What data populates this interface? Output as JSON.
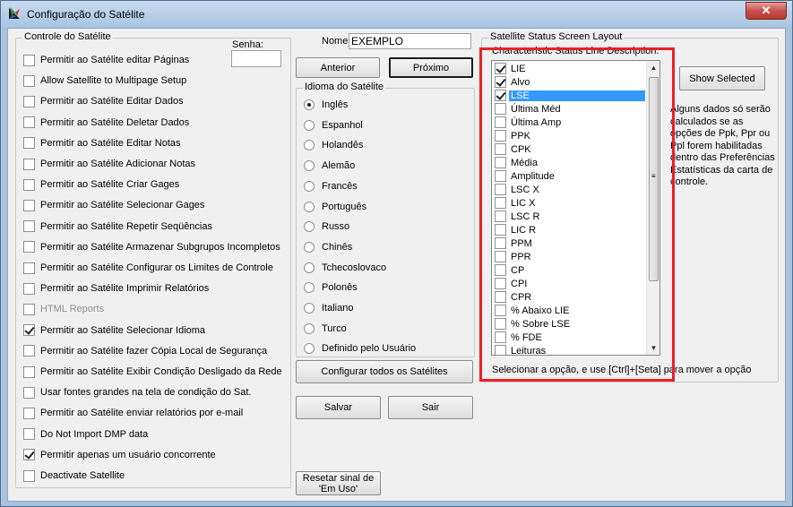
{
  "window": {
    "title": "Configuração do Satélite",
    "close_label": "✕",
    "accent": "#3399ff",
    "highlight": "#e8202a"
  },
  "controle": {
    "legend": "Controle do Satélite",
    "senha_label": "Senha:",
    "senha_value": "",
    "items": [
      {
        "label": "Permitir ao Satélite editar Páginas",
        "checked": false,
        "disabled": false
      },
      {
        "label": "Allow Satellite to Multipage Setup",
        "checked": false,
        "disabled": false
      },
      {
        "label": "Permitir ao Satélite Editar Dados",
        "checked": false,
        "disabled": false
      },
      {
        "label": "Permitir ao Satélite Deletar Dados",
        "checked": false,
        "disabled": false
      },
      {
        "label": "Permitir ao Satélite Editar Notas",
        "checked": false,
        "disabled": false
      },
      {
        "label": "Permitir ao Satélite Adicionar Notas",
        "checked": false,
        "disabled": false
      },
      {
        "label": "Permitir ao Satélite Criar Gages",
        "checked": false,
        "disabled": false
      },
      {
        "label": "Permitir ao Satélite Selecionar Gages",
        "checked": false,
        "disabled": false
      },
      {
        "label": "Permitir ao Satélite Repetir Seqüências",
        "checked": false,
        "disabled": false
      },
      {
        "label": "Permitir ao Satélite Armazenar Subgrupos Incompletos",
        "checked": false,
        "disabled": false
      },
      {
        "label": "Permitir ao Satélite Configurar os Limites de Controle",
        "checked": false,
        "disabled": false
      },
      {
        "label": "Permitir ao Satélite Imprimir Relatórios",
        "checked": false,
        "disabled": false
      },
      {
        "label": "HTML Reports",
        "checked": false,
        "disabled": true
      },
      {
        "label": "Permitir ao Satélite Selecionar Idioma",
        "checked": true,
        "disabled": false
      },
      {
        "label": "Permitir ao Satélite fazer Cópia Local de Segurança",
        "checked": false,
        "disabled": false
      },
      {
        "label": "Permitir ao Satélite Exibir Condição Desligado da Rede",
        "checked": false,
        "disabled": false
      },
      {
        "label": "Usar fontes grandes na tela de condição do Sat.",
        "checked": false,
        "disabled": false
      },
      {
        "label": "Permitir ao Satélite enviar relatórios por e-mail",
        "checked": false,
        "disabled": false
      },
      {
        "label": "Do Not Import DMP data",
        "checked": false,
        "disabled": false
      },
      {
        "label": "Permitir apenas um usuário concorrente",
        "checked": true,
        "disabled": false
      },
      {
        "label": "Deactivate Satellite",
        "checked": false,
        "disabled": false
      }
    ]
  },
  "nome": {
    "label": "Nome",
    "value": "EXEMPLO"
  },
  "nav": {
    "anterior": "Anterior",
    "proximo": "Próximo"
  },
  "idioma": {
    "legend": "Idioma do Satélite",
    "options": [
      {
        "label": "Inglês",
        "selected": true
      },
      {
        "label": "Espanhol",
        "selected": false
      },
      {
        "label": "Holandês",
        "selected": false
      },
      {
        "label": "Alemão",
        "selected": false
      },
      {
        "label": "Francês",
        "selected": false
      },
      {
        "label": "Português",
        "selected": false
      },
      {
        "label": "Russo",
        "selected": false
      },
      {
        "label": "Chinês",
        "selected": false
      },
      {
        "label": "Tchecoslovaco",
        "selected": false
      },
      {
        "label": "Polonês",
        "selected": false
      },
      {
        "label": "Italiano",
        "selected": false
      },
      {
        "label": "Turco",
        "selected": false
      },
      {
        "label": "Definido pelo Usuário",
        "selected": false
      }
    ]
  },
  "buttons": {
    "configurar": "Configurar todos os Satélites",
    "salvar": "Salvar",
    "sair": "Sair",
    "resetar": "Resetar sinal de 'Em Uso'",
    "show_selected": "Show Selected"
  },
  "status_layout": {
    "legend": "Satellite Status Screen Layout",
    "list_caption": "Characteristic Status Line  Description:",
    "items": [
      {
        "label": "LIE",
        "checked": true,
        "selected": false
      },
      {
        "label": "Alvo",
        "checked": true,
        "selected": false
      },
      {
        "label": "LSE",
        "checked": true,
        "selected": true
      },
      {
        "label": "Última Méd",
        "checked": false,
        "selected": false
      },
      {
        "label": "Última Amp",
        "checked": false,
        "selected": false
      },
      {
        "label": "PPK",
        "checked": false,
        "selected": false
      },
      {
        "label": "CPK",
        "checked": false,
        "selected": false
      },
      {
        "label": "Média",
        "checked": false,
        "selected": false
      },
      {
        "label": "Amplitude",
        "checked": false,
        "selected": false
      },
      {
        "label": "LSC X",
        "checked": false,
        "selected": false
      },
      {
        "label": "LIC X",
        "checked": false,
        "selected": false
      },
      {
        "label": "LSC R",
        "checked": false,
        "selected": false
      },
      {
        "label": "LIC R",
        "checked": false,
        "selected": false
      },
      {
        "label": "PPM",
        "checked": false,
        "selected": false
      },
      {
        "label": "PPR",
        "checked": false,
        "selected": false
      },
      {
        "label": "CP",
        "checked": false,
        "selected": false
      },
      {
        "label": "CPI",
        "checked": false,
        "selected": false
      },
      {
        "label": "CPR",
        "checked": false,
        "selected": false
      },
      {
        "label": "% Abaixo LIE",
        "checked": false,
        "selected": false
      },
      {
        "label": "% Sobre LSE",
        "checked": false,
        "selected": false
      },
      {
        "label": "% FDE",
        "checked": false,
        "selected": false
      },
      {
        "label": "Leituras",
        "checked": false,
        "selected": false
      }
    ],
    "hint": "Selecionar a opção, e use [Ctrl]+[Seta] para mover a opção",
    "note_lines": [
      "Alguns dados só serão",
      "calculados se as",
      "opções de Ppk, Ppr ou",
      "Ppl forem habilitadas",
      "dentro das Preferências",
      "Estatísticas da carta de",
      "controle."
    ]
  }
}
